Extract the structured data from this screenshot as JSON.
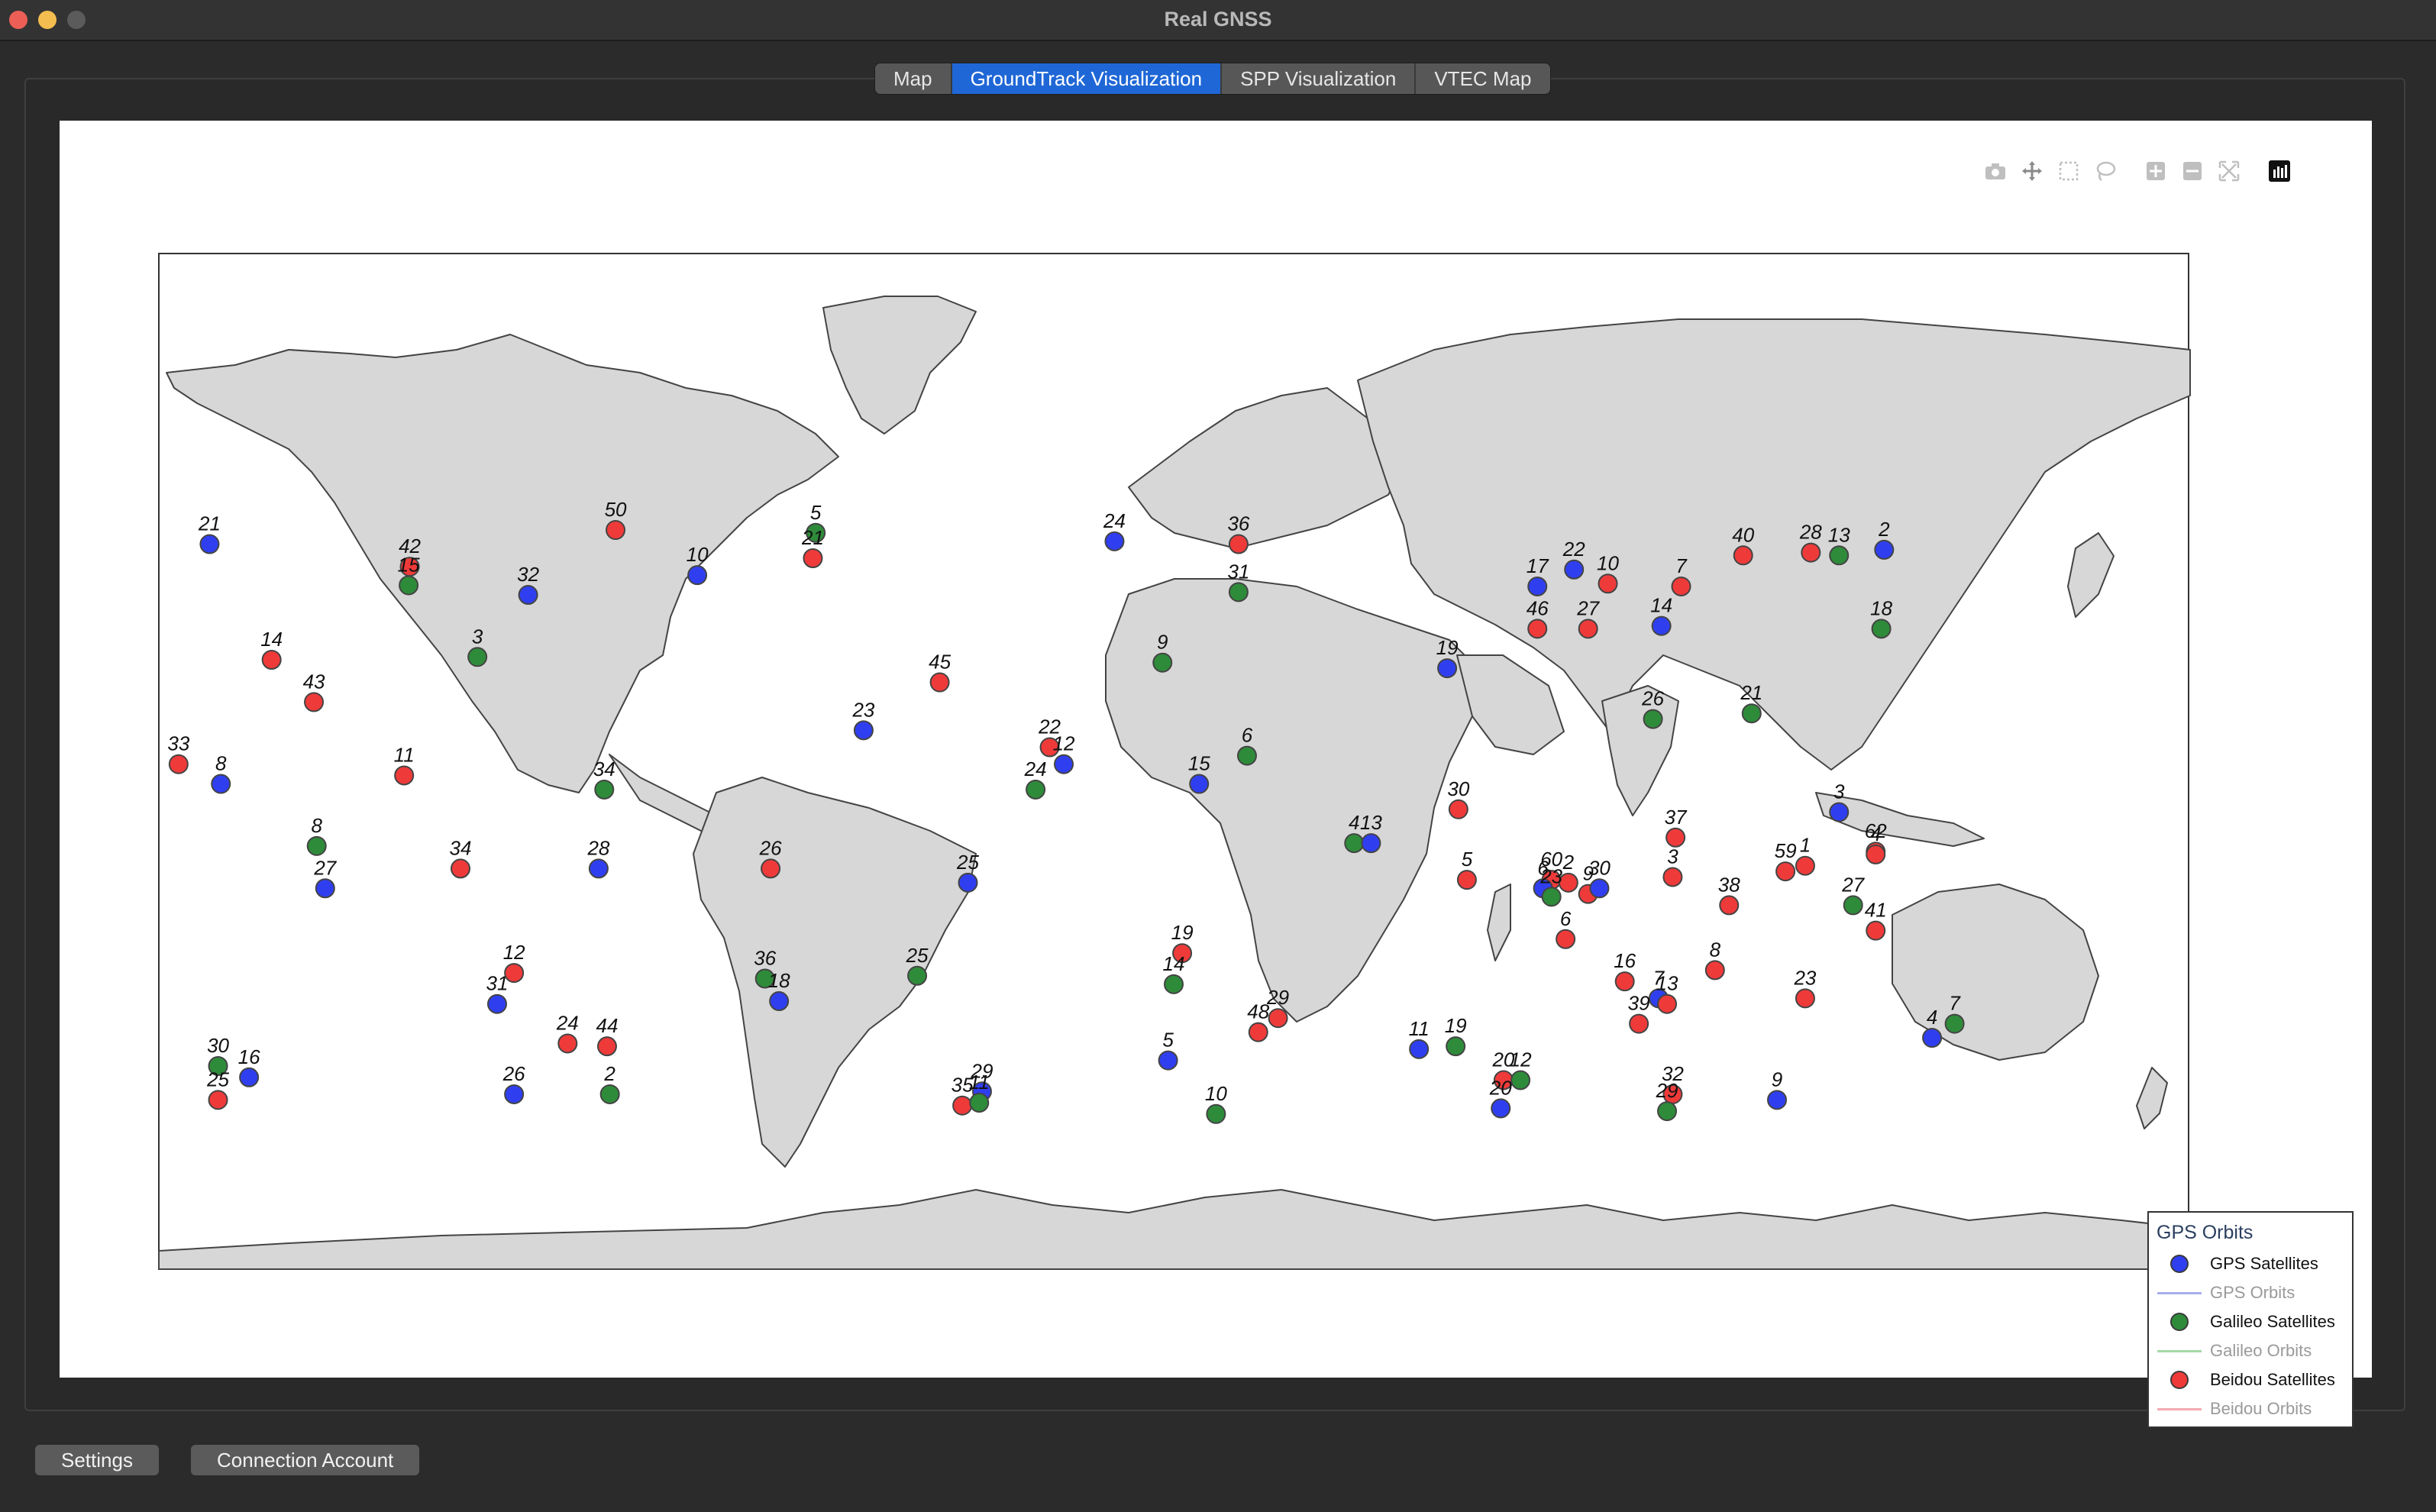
{
  "window": {
    "title": "Real GNSS"
  },
  "tabs": [
    {
      "label": "Map",
      "active": false
    },
    {
      "label": "GroundTrack Visualization",
      "active": true
    },
    {
      "label": "SPP Visualization",
      "active": false
    },
    {
      "label": "VTEC Map",
      "active": false
    }
  ],
  "modebar": [
    "camera-icon",
    "pan-icon",
    "box-select-icon",
    "lasso-icon",
    "zoom-in-icon",
    "zoom-out-icon",
    "autoscale-icon",
    "plotly-logo-icon"
  ],
  "legend": {
    "title": "GPS Orbits",
    "items": [
      {
        "label": "GPS Satellites",
        "kind": "marker",
        "color": "#2f3ff0"
      },
      {
        "label": "GPS Orbits",
        "kind": "line",
        "color": "#a9aef0"
      },
      {
        "label": "Galileo Satellites",
        "kind": "marker",
        "color": "#2e8b3a"
      },
      {
        "label": "Galileo Orbits",
        "kind": "line",
        "color": "#a6d9a6"
      },
      {
        "label": "Beidou Satellites",
        "kind": "marker",
        "color": "#ef3a3a"
      },
      {
        "label": "Beidou Orbits",
        "kind": "line",
        "color": "#f4aab0"
      }
    ]
  },
  "satellites": [
    {
      "label": "21",
      "c": "gps",
      "lon": -171.0,
      "lat": 38.5
    },
    {
      "label": "42",
      "c": "beidou",
      "lon": -135.5,
      "lat": 34.5
    },
    {
      "label": "15",
      "c": "galileo",
      "lon": -135.7,
      "lat": 31.2
    },
    {
      "label": "50",
      "c": "beidou",
      "lon": -99.0,
      "lat": 41.0
    },
    {
      "label": "32",
      "c": "gps",
      "lon": -114.5,
      "lat": 29.5
    },
    {
      "label": "10",
      "c": "gps",
      "lon": -84.5,
      "lat": 33.0
    },
    {
      "label": "5",
      "c": "galileo",
      "lon": -63.5,
      "lat": 40.5
    },
    {
      "label": "21",
      "c": "beidou",
      "lon": -64.0,
      "lat": 36.0
    },
    {
      "label": "3",
      "c": "galileo",
      "lon": -123.5,
      "lat": 18.5
    },
    {
      "label": "14",
      "c": "beidou",
      "lon": -160.0,
      "lat": 18.0
    },
    {
      "label": "43",
      "c": "beidou",
      "lon": -152.5,
      "lat": 10.5
    },
    {
      "label": "45",
      "c": "beidou",
      "lon": -41.5,
      "lat": 14.0
    },
    {
      "label": "23",
      "c": "gps",
      "lon": -55.0,
      "lat": 5.5
    },
    {
      "label": "33",
      "c": "beidou",
      "lon": -176.5,
      "lat": -0.5
    },
    {
      "label": "8",
      "c": "gps",
      "lon": -169.0,
      "lat": -4.0
    },
    {
      "label": "11",
      "c": "beidou",
      "lon": -136.5,
      "lat": -2.5
    },
    {
      "label": "34",
      "c": "galileo",
      "lon": -101.0,
      "lat": -5.0
    },
    {
      "label": "24",
      "c": "gps",
      "lon": -10.5,
      "lat": 39.0
    },
    {
      "label": "36",
      "c": "beidou",
      "lon": 11.5,
      "lat": 38.5
    },
    {
      "label": "31",
      "c": "galileo",
      "lon": 11.5,
      "lat": 30.0
    },
    {
      "label": "9",
      "c": "galileo",
      "lon": -2.0,
      "lat": 17.5
    },
    {
      "label": "22",
      "c": "beidou",
      "lon": -22.0,
      "lat": 2.5
    },
    {
      "label": "12",
      "c": "gps",
      "lon": -19.5,
      "lat": -0.5
    },
    {
      "label": "24",
      "c": "galileo",
      "lon": -24.5,
      "lat": -5.0
    },
    {
      "label": "15",
      "c": "gps",
      "lon": 4.5,
      "lat": -4.0
    },
    {
      "label": "6",
      "c": "galileo",
      "lon": 13.0,
      "lat": 1.0
    },
    {
      "label": "8",
      "c": "galileo",
      "lon": -152.0,
      "lat": -15.0
    },
    {
      "label": "27",
      "c": "gps",
      "lon": -150.5,
      "lat": -22.5
    },
    {
      "label": "34",
      "c": "beidou",
      "lon": -126.5,
      "lat": -19.0
    },
    {
      "label": "28",
      "c": "gps",
      "lon": -102.0,
      "lat": -19.0
    },
    {
      "label": "26",
      "c": "beidou",
      "lon": -71.5,
      "lat": -19.0
    },
    {
      "label": "25",
      "c": "gps",
      "lon": -36.5,
      "lat": -21.5
    },
    {
      "label": "4",
      "c": "galileo",
      "lon": 32.0,
      "lat": -14.5
    },
    {
      "label": "13",
      "c": "gps",
      "lon": 35.0,
      "lat": -14.5
    },
    {
      "label": "30",
      "c": "beidou",
      "lon": 50.5,
      "lat": -8.5
    },
    {
      "label": "5",
      "c": "beidou",
      "lon": 52.0,
      "lat": -21.0
    },
    {
      "label": "19",
      "c": "beidou",
      "lon": 1.5,
      "lat": -34.0
    },
    {
      "label": "14",
      "c": "galileo",
      "lon": 0.0,
      "lat": -39.5
    },
    {
      "label": "25",
      "c": "galileo",
      "lon": -45.5,
      "lat": -38.0
    },
    {
      "label": "36",
      "c": "galileo",
      "lon": -72.5,
      "lat": -38.5
    },
    {
      "label": "18",
      "c": "gps",
      "lon": -70.0,
      "lat": -42.5
    },
    {
      "label": "12",
      "c": "beidou",
      "lon": -117.0,
      "lat": -37.5
    },
    {
      "label": "31",
      "c": "gps",
      "lon": -120.0,
      "lat": -43.0
    },
    {
      "label": "24",
      "c": "beidou",
      "lon": -107.5,
      "lat": -50.0
    },
    {
      "label": "44",
      "c": "beidou",
      "lon": -100.5,
      "lat": -50.5
    },
    {
      "label": "29",
      "c": "beidou",
      "lon": 18.5,
      "lat": -45.5
    },
    {
      "label": "48",
      "c": "beidou",
      "lon": 15.0,
      "lat": -48.0
    },
    {
      "label": "5",
      "c": "gps",
      "lon": -1.0,
      "lat": -53.0
    },
    {
      "label": "30",
      "c": "galileo",
      "lon": -169.5,
      "lat": -54.0
    },
    {
      "label": "16",
      "c": "gps",
      "lon": -164.0,
      "lat": -56.0
    },
    {
      "label": "25",
      "c": "beidou",
      "lon": -169.5,
      "lat": -60.0
    },
    {
      "label": "26",
      "c": "gps",
      "lon": -117.0,
      "lat": -59.0
    },
    {
      "label": "2",
      "c": "galileo",
      "lon": -100.0,
      "lat": -59.0
    },
    {
      "label": "35",
      "c": "beidou",
      "lon": -37.5,
      "lat": -61.0
    },
    {
      "label": "29",
      "c": "gps",
      "lon": -34.0,
      "lat": -58.5
    },
    {
      "label": "11",
      "c": "galileo",
      "lon": -34.5,
      "lat": -60.5
    },
    {
      "label": "10",
      "c": "galileo",
      "lon": 7.5,
      "lat": -62.5
    },
    {
      "label": "11",
      "c": "gps",
      "lon": 43.5,
      "lat": -51.0
    },
    {
      "label": "19",
      "c": "galileo",
      "lon": 50.0,
      "lat": -50.5
    },
    {
      "label": "20",
      "c": "beidou",
      "lon": 58.5,
      "lat": -56.5
    },
    {
      "label": "12",
      "c": "galileo",
      "lon": 61.5,
      "lat": -56.5
    },
    {
      "label": "20",
      "c": "gps",
      "lon": 58.0,
      "lat": -61.5
    },
    {
      "label": "17",
      "c": "gps",
      "lon": 64.5,
      "lat": 31.0
    },
    {
      "label": "22",
      "c": "gps",
      "lon": 71.0,
      "lat": 34.0
    },
    {
      "label": "10",
      "c": "beidou",
      "lon": 77.0,
      "lat": 31.5
    },
    {
      "label": "7",
      "c": "beidou",
      "lon": 90.0,
      "lat": 31.0
    },
    {
      "label": "40",
      "c": "beidou",
      "lon": 101.0,
      "lat": 36.5
    },
    {
      "label": "28",
      "c": "beidou",
      "lon": 113.0,
      "lat": 37.0
    },
    {
      "label": "13",
      "c": "galileo",
      "lon": 118.0,
      "lat": 36.5
    },
    {
      "label": "2",
      "c": "gps",
      "lon": 126.0,
      "lat": 37.5
    },
    {
      "label": "46",
      "c": "beidou",
      "lon": 64.5,
      "lat": 23.5
    },
    {
      "label": "27",
      "c": "beidou",
      "lon": 73.5,
      "lat": 23.5
    },
    {
      "label": "14",
      "c": "gps",
      "lon": 86.5,
      "lat": 24.0
    },
    {
      "label": "18",
      "c": "galileo",
      "lon": 125.5,
      "lat": 23.5
    },
    {
      "label": "19",
      "c": "gps",
      "lon": 48.5,
      "lat": 16.5
    },
    {
      "label": "26",
      "c": "galileo",
      "lon": 85.0,
      "lat": 7.5
    },
    {
      "label": "21",
      "c": "galileo",
      "lon": 102.5,
      "lat": 8.5
    },
    {
      "label": "3",
      "c": "gps",
      "lon": 118.0,
      "lat": -9.0
    },
    {
      "label": "37",
      "c": "beidou",
      "lon": 89.0,
      "lat": -13.5
    },
    {
      "label": "62",
      "c": "beidou",
      "lon": 124.5,
      "lat": -16.0
    },
    {
      "label": "4",
      "c": "beidou",
      "lon": 124.5,
      "lat": -16.5
    },
    {
      "label": "60",
      "c": "beidou",
      "lon": 67.0,
      "lat": -21.0
    },
    {
      "label": "2",
      "c": "beidou",
      "lon": 70.0,
      "lat": -21.5
    },
    {
      "label": "6",
      "c": "gps",
      "lon": 65.5,
      "lat": -22.5
    },
    {
      "label": "23",
      "c": "galileo",
      "lon": 67.0,
      "lat": -24.0
    },
    {
      "label": "9",
      "c": "beidou",
      "lon": 73.5,
      "lat": -23.5
    },
    {
      "label": "30",
      "c": "gps",
      "lon": 75.5,
      "lat": -22.5
    },
    {
      "label": "3",
      "c": "beidou",
      "lon": 88.5,
      "lat": -20.5
    },
    {
      "label": "59",
      "c": "beidou",
      "lon": 108.5,
      "lat": -19.5
    },
    {
      "label": "1",
      "c": "beidou",
      "lon": 112.0,
      "lat": -18.5
    },
    {
      "label": "38",
      "c": "beidou",
      "lon": 98.5,
      "lat": -25.5
    },
    {
      "label": "27",
      "c": "galileo",
      "lon": 120.5,
      "lat": -25.5
    },
    {
      "label": "41",
      "c": "beidou",
      "lon": 124.5,
      "lat": -30.0
    },
    {
      "label": "6",
      "c": "beidou",
      "lon": 69.5,
      "lat": -31.5
    },
    {
      "label": "16",
      "c": "beidou",
      "lon": 80.0,
      "lat": -39.0
    },
    {
      "label": "8",
      "c": "beidou",
      "lon": 96.0,
      "lat": -37.0
    },
    {
      "label": "7",
      "c": "gps",
      "lon": 86.0,
      "lat": -42.0
    },
    {
      "label": "13",
      "c": "beidou",
      "lon": 87.5,
      "lat": -43.0
    },
    {
      "label": "39",
      "c": "beidou",
      "lon": 82.5,
      "lat": -46.5
    },
    {
      "label": "23",
      "c": "beidou",
      "lon": 112.0,
      "lat": -42.0
    },
    {
      "label": "4",
      "c": "gps",
      "lon": 134.5,
      "lat": -49.0
    },
    {
      "label": "7",
      "c": "galileo",
      "lon": 138.5,
      "lat": -46.5
    },
    {
      "label": "32",
      "c": "beidou",
      "lon": 88.5,
      "lat": -59.0
    },
    {
      "label": "29",
      "c": "galileo",
      "lon": 87.5,
      "lat": -62.0
    },
    {
      "label": "9",
      "c": "gps",
      "lon": 107.0,
      "lat": -60.0
    }
  ],
  "buttons": {
    "settings": "Settings",
    "connection": "Connection Account"
  }
}
